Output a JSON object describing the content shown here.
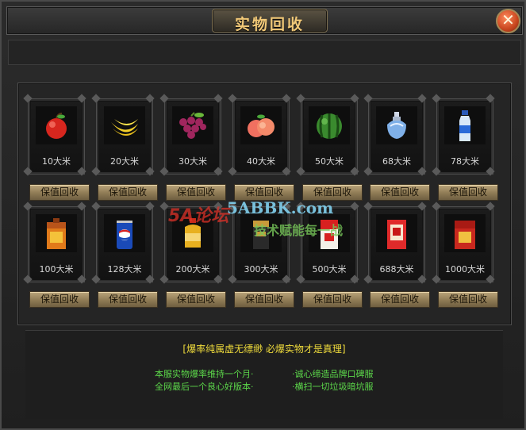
{
  "title": "实物回收",
  "close_glyph": "✕",
  "button_label": "保值回收",
  "items": [
    {
      "price": "10大米",
      "icon": "apple-icon"
    },
    {
      "price": "20大米",
      "icon": "banana-icon"
    },
    {
      "price": "30大米",
      "icon": "grapes-icon"
    },
    {
      "price": "40大米",
      "icon": "peach-icon"
    },
    {
      "price": "50大米",
      "icon": "watermelon-icon"
    },
    {
      "price": "68大米",
      "icon": "perfume-icon"
    },
    {
      "price": "78大米",
      "icon": "drink-bottle-icon"
    },
    {
      "price": "100大米",
      "icon": "wine-box-icon"
    },
    {
      "price": "128大米",
      "icon": "pepsi-can-icon"
    },
    {
      "price": "200大米",
      "icon": "oil-bottle-icon"
    },
    {
      "price": "300大米",
      "icon": "cigarette-pack-icon"
    },
    {
      "price": "500大米",
      "icon": "cigarette-box-icon"
    },
    {
      "price": "688大米",
      "icon": "cigarette-carton-icon"
    },
    {
      "price": "1000大米",
      "icon": "gift-box-icon"
    }
  ],
  "slogan": "[爆率纯属虚无缥缈 必爆实物才是真理]",
  "notes": [
    "本服实物爆率维持一个月·",
    "·诚心缔造品牌口碑服",
    "全网最后一个良心好版本·",
    "·横扫一切垃圾暗坑服"
  ],
  "watermark": {
    "logo": "5A论坛",
    "site": "5ABBK.com",
    "tagline": "技术赋能每一战"
  },
  "colors": {
    "title": "#f2c978",
    "slogan": "#f0dc3c",
    "notes": "#5cd84a",
    "button": "#a89166"
  }
}
